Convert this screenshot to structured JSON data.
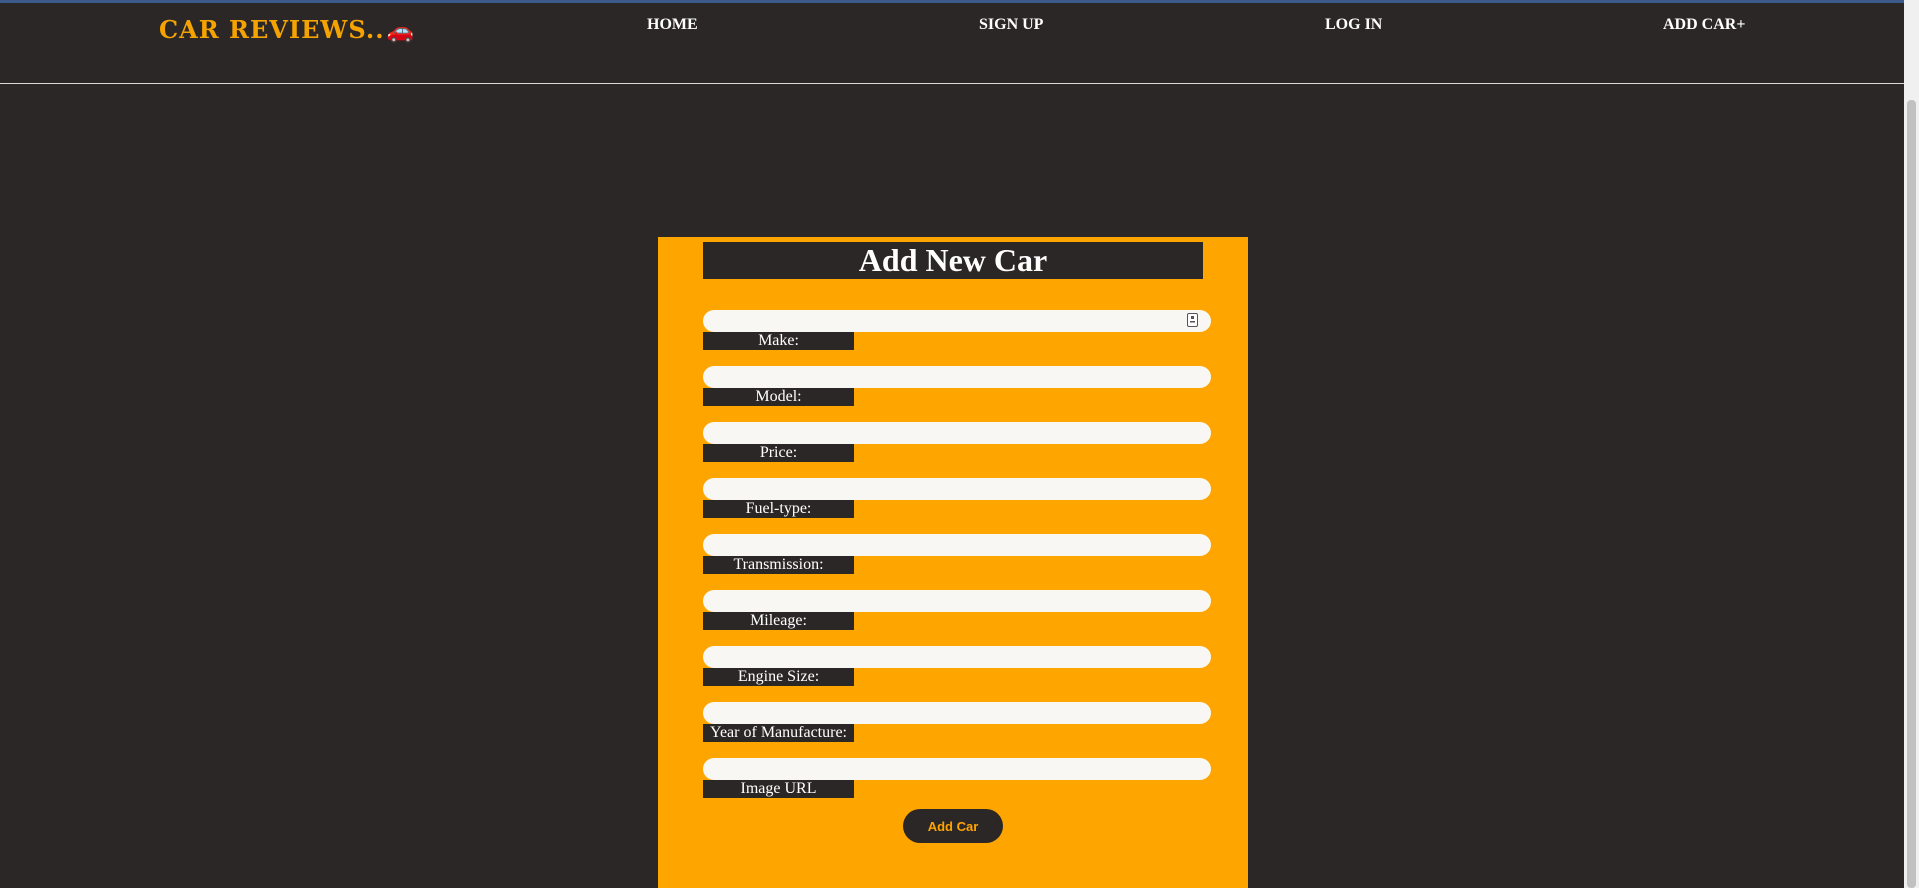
{
  "brand": {
    "name": "CAR REVIEWS..",
    "icon": "🚗"
  },
  "nav": {
    "home": "HOME",
    "signup": "SIGN UP",
    "login": "LOG IN",
    "addcar": "ADD CAR+"
  },
  "form": {
    "title": "Add New Car",
    "fields": [
      {
        "label": "Make:",
        "value": ""
      },
      {
        "label": "Model:",
        "value": ""
      },
      {
        "label": "Price:",
        "value": ""
      },
      {
        "label": "Fuel-type:",
        "value": ""
      },
      {
        "label": "Transmission:",
        "value": ""
      },
      {
        "label": "Mileage:",
        "value": ""
      },
      {
        "label": "Engine Size:",
        "value": ""
      },
      {
        "label": "Year of Manufacture:",
        "value": ""
      },
      {
        "label": "Image URL",
        "value": ""
      }
    ],
    "submit_label": "Add Car"
  },
  "colors": {
    "background": "#2c2727",
    "accent": "#ffa500",
    "input_bg": "#f9f7f3"
  }
}
